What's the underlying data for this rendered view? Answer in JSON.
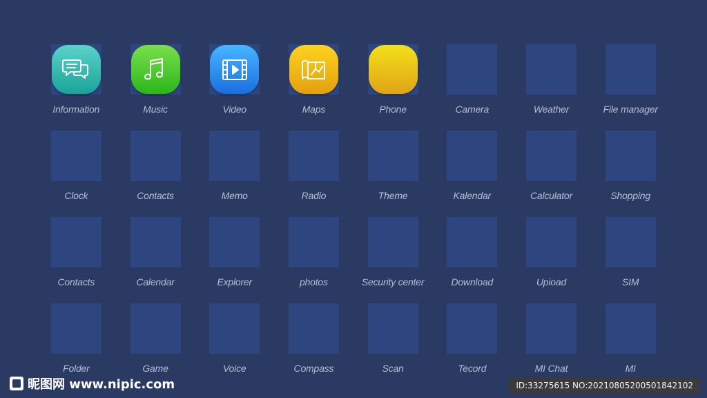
{
  "apps": [
    {
      "label": "Information",
      "icon": "chat-bubbles-icon",
      "color_top": "#5bd3c8",
      "color_bottom": "#1aa39a"
    },
    {
      "label": "Music",
      "icon": "music-note-icon",
      "color_top": "#79e04b",
      "color_bottom": "#2bb61a"
    },
    {
      "label": "Video",
      "icon": "film-play-icon",
      "color_top": "#47b6ff",
      "color_bottom": "#1a6ee0"
    },
    {
      "label": "Maps",
      "icon": "folded-map-icon",
      "color_top": "#ffd21f",
      "color_bottom": "#e2a00e"
    },
    {
      "label": "Phone",
      "icon": "phone-blank-icon",
      "color_top": "#f2e11a",
      "color_bottom": "#e1a318"
    },
    {
      "label": "Camera"
    },
    {
      "label": "Weather"
    },
    {
      "label": "File manager"
    },
    {
      "label": "Clock"
    },
    {
      "label": "Contacts"
    },
    {
      "label": "Memo"
    },
    {
      "label": "Radio"
    },
    {
      "label": "Theme"
    },
    {
      "label": "Kalendar"
    },
    {
      "label": "Calculator"
    },
    {
      "label": "Shopping"
    },
    {
      "label": "Contacts"
    },
    {
      "label": "Calendar"
    },
    {
      "label": "Explorer"
    },
    {
      "label": "photos"
    },
    {
      "label": "Security center"
    },
    {
      "label": "Download"
    },
    {
      "label": "Upioad"
    },
    {
      "label": "SIM"
    },
    {
      "label": "Folder"
    },
    {
      "label": "Game"
    },
    {
      "label": "Voice"
    },
    {
      "label": "Compass"
    },
    {
      "label": "Scan"
    },
    {
      "label": "Tecord"
    },
    {
      "label": "MI Chat"
    },
    {
      "label": "MI"
    }
  ],
  "watermark": {
    "site": "昵图网 www.nipic.com",
    "id_text": "ID:33275615 NO:20210805200501842102"
  }
}
